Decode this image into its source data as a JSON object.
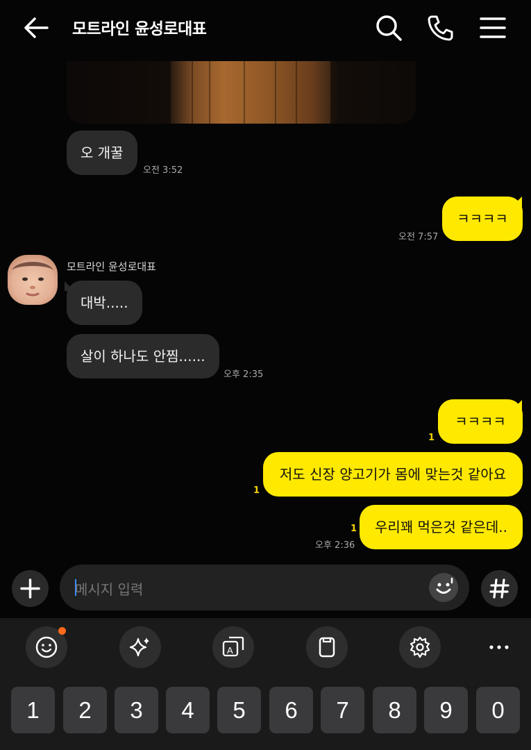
{
  "header": {
    "title": "모트라인 윤성로대표"
  },
  "messages": {
    "m1": {
      "text": "오 개꿀",
      "time": "오전 3:52"
    },
    "m2": {
      "text": "ㅋㅋㅋㅋ",
      "time": "오전 7:57"
    },
    "sender_name": "모트라인 윤성로대표",
    "m3": {
      "text": "대박....."
    },
    "m4": {
      "text": "살이 하나도 안찜......",
      "time": "오후 2:35"
    },
    "m5": {
      "text": "ㅋㅋㅋㅋ",
      "unread": "1"
    },
    "m6": {
      "text": "저도 신장 양고기가 몸에 맞는것 같아요",
      "unread": "1"
    },
    "m7": {
      "text": "우리꽤 먹은것 같은데..",
      "unread": "1",
      "time": "오후 2:36"
    }
  },
  "input": {
    "placeholder": "메시지 입력"
  },
  "keyboard": {
    "numbers": [
      "1",
      "2",
      "3",
      "4",
      "5",
      "6",
      "7",
      "8",
      "9",
      "0"
    ]
  },
  "colors": {
    "bubble_out": "#ffe900",
    "bubble_in": "#2b2b2b",
    "background": "#050505"
  }
}
